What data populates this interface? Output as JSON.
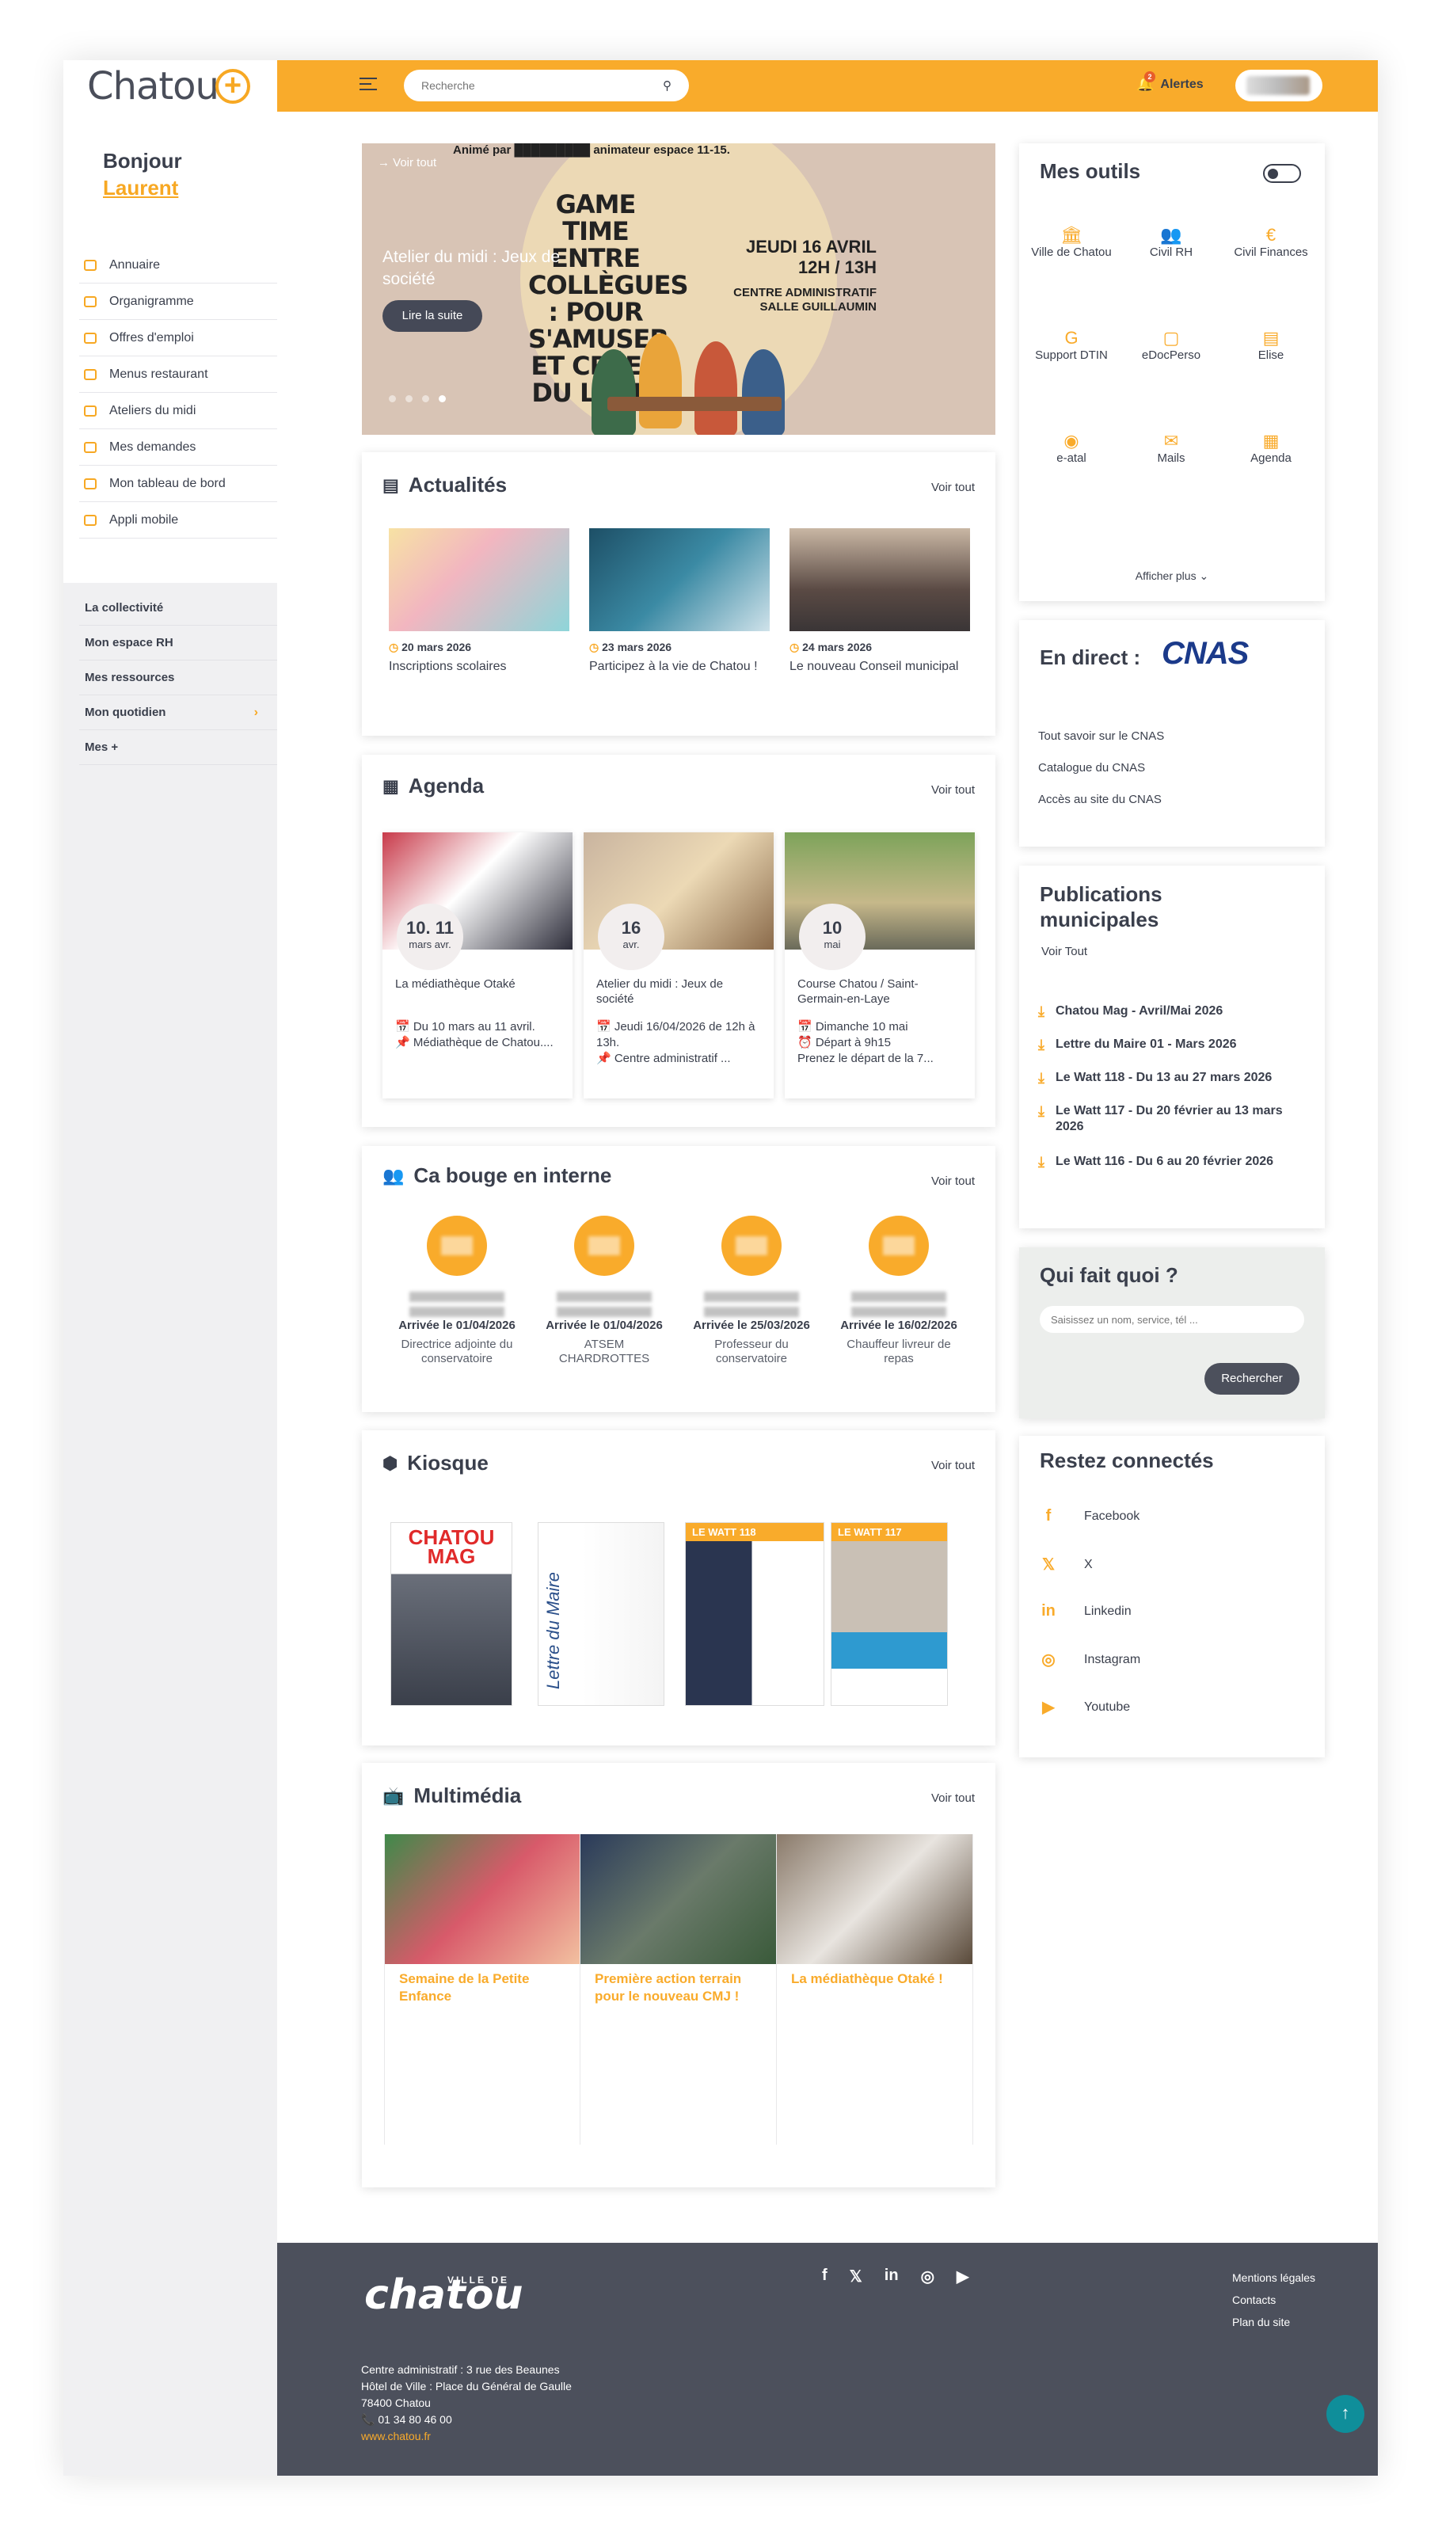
{
  "brand": {
    "logo": "Chatou",
    "accent": "#f9ab2b"
  },
  "topbar": {
    "search_placeholder": "Recherche",
    "alerts_label": "Alertes",
    "alerts_count": "2"
  },
  "sidebar": {
    "greeting": "Bonjour",
    "user_name": "Laurent",
    "items": [
      {
        "label": "Annuaire"
      },
      {
        "label": "Organigramme"
      },
      {
        "label": "Offres d'emploi"
      },
      {
        "label": "Menus restaurant"
      },
      {
        "label": "Ateliers du midi"
      },
      {
        "label": "Mes demandes"
      },
      {
        "label": "Mon tableau de bord"
      },
      {
        "label": "Appli mobile"
      }
    ],
    "sections": [
      {
        "label": "La collectivité"
      },
      {
        "label": "Mon espace RH"
      },
      {
        "label": "Mes ressources"
      },
      {
        "label": "Mon quotidien"
      },
      {
        "label": "Mes +"
      }
    ]
  },
  "hero": {
    "voir_tout": "→ Voir tout",
    "animated_by": "Animé par █████████ animateur espace 11-15.",
    "title": "Atelier du midi : Jeux de société",
    "button": "Lire la suite",
    "poster_title": "GAME TIME ENTRE COLLÈGUES : POUR S'AMUSER ET CRÉER DU LIEN !",
    "poster_date": "JEUDI 16 AVRIL 12H / 13H",
    "poster_place": "CENTRE ADMINISTRATIF SALLE GUILLAUMIN"
  },
  "actualites": {
    "title": "Actualités",
    "voir_tout": "Voir tout",
    "items": [
      {
        "date": "20 mars 2026",
        "title": "Inscriptions scolaires"
      },
      {
        "date": "23 mars 2026",
        "title": "Participez à la vie de Chatou !"
      },
      {
        "date": "24 mars 2026",
        "title": "Le nouveau Conseil municipal"
      }
    ]
  },
  "agenda": {
    "title": "Agenda",
    "voir_tout": "Voir tout",
    "items": [
      {
        "day": "10. 11",
        "month": "mars   avr.",
        "title": "La médiathèque Otaké",
        "line1": "📅 Du 10 mars au 11 avril.",
        "line2": "📌 Médiathèque de Chatou...."
      },
      {
        "day": "16",
        "month": "avr.",
        "title": "Atelier du midi : Jeux de société",
        "line1": "📅 Jeudi 16/04/2026 de 12h à 13h.",
        "line2": "📌 Centre administratif ..."
      },
      {
        "day": "10",
        "month": "mai",
        "title": "Course Chatou / Saint-Germain-en-Laye",
        "line1": "📅 Dimanche 10 mai",
        "line2": "⏰ Départ à 9h15",
        "line3": "Prenez le départ de la 7..."
      }
    ]
  },
  "interne": {
    "title": "Ca bouge en interne",
    "voir_tout": "Voir tout",
    "people": [
      {
        "arrival": "Arrivée le 01/04/2026",
        "role": "Directrice adjointe du conservatoire"
      },
      {
        "arrival": "Arrivée le 01/04/2026",
        "role": "ATSEM CHARDROTTES"
      },
      {
        "arrival": "Arrivée le 25/03/2026",
        "role": "Professeur du conservatoire"
      },
      {
        "arrival": "Arrivée le 16/02/2026",
        "role": "Chauffeur livreur de repas"
      }
    ]
  },
  "kiosque": {
    "title": "Kiosque",
    "voir_tout": "Voir tout",
    "covers": [
      {
        "label": "CHATOU MAG"
      },
      {
        "label": "Lettre du Maire"
      },
      {
        "label": "LE WATT 118"
      },
      {
        "label": "LE WATT 117"
      }
    ]
  },
  "multimedia": {
    "title": "Multimédia",
    "voir_tout": "Voir tout",
    "items": [
      {
        "title": "Semaine de la Petite Enfance"
      },
      {
        "title": "Première action terrain pour le nouveau CMJ !"
      },
      {
        "title": "La médiathèque Otaké !"
      }
    ]
  },
  "outils": {
    "title": "Mes outils",
    "items": [
      {
        "label": "Ville de Chatou",
        "icon": "building-icon"
      },
      {
        "label": "Civil RH",
        "icon": "users-icon"
      },
      {
        "label": "Civil Finances",
        "icon": "euro-icon"
      },
      {
        "label": "Support DTIN",
        "icon": "support-icon"
      },
      {
        "label": "eDocPerso",
        "icon": "doc-icon"
      },
      {
        "label": "Elise",
        "icon": "file-icon"
      },
      {
        "label": "e-atal",
        "icon": "binoculars-icon"
      },
      {
        "label": "Mails",
        "icon": "mail-icon"
      },
      {
        "label": "Agenda",
        "icon": "calendar-icon"
      }
    ],
    "more": "Afficher plus ⌄"
  },
  "cnas": {
    "title": "En direct :",
    "logo": "CNAS",
    "links": [
      "Tout savoir sur le CNAS",
      "Catalogue du CNAS",
      "Accès au site du CNAS"
    ]
  },
  "publications": {
    "title": "Publications municipales",
    "voir_tout": "Voir Tout",
    "items": [
      "Chatou Mag - Avril/Mai 2026",
      "Lettre du Maire 01 - Mars 2026",
      "Le Watt 118 - Du 13 au 27 mars 2026",
      "Le Watt 117 - Du 20 février au 13 mars 2026",
      "Le Watt 116 - Du 6 au 20 février 2026"
    ]
  },
  "quifait": {
    "title": "Qui fait quoi ?",
    "placeholder": "Saisissez un nom, service, tél ...",
    "button": "Rechercher"
  },
  "connectes": {
    "title": "Restez connectés",
    "items": [
      "Facebook",
      "X",
      "Linkedin",
      "Instagram",
      "Youtube"
    ]
  },
  "footer": {
    "ville": "VILLE DE",
    "logo": "chatou",
    "addr1": "Centre administratif : 3 rue des Beaunes",
    "addr2": "Hôtel de Ville : Place du Général de Gaulle",
    "addr3": "78400 Chatou",
    "phone": "📞 01 34 80 46 00",
    "www": "www.chatou.fr",
    "links": [
      "Mentions légales",
      "Contacts",
      "Plan du site"
    ]
  }
}
